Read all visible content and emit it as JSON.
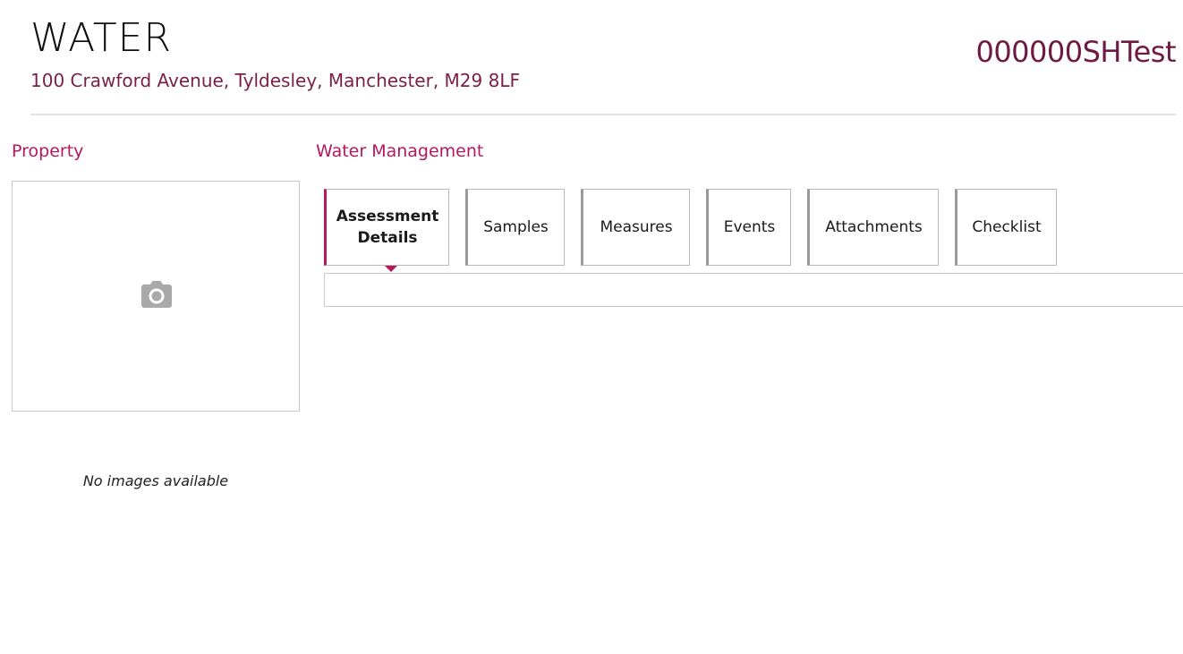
{
  "header": {
    "title": "WATER",
    "address": "100 Crawford Avenue, Tyldesley, Manchester, M29 8LF",
    "reference": "000000SHTest"
  },
  "property": {
    "heading": "Property",
    "image_icon": "camera-icon",
    "no_images_text": "No images available"
  },
  "water_management": {
    "heading": "Water Management",
    "active_tab": "Assessment Details",
    "tabs": [
      {
        "label": "Assessment Details"
      },
      {
        "label": "Samples"
      },
      {
        "label": "Measures"
      },
      {
        "label": "Events"
      },
      {
        "label": "Attachments"
      },
      {
        "label": "Checklist"
      }
    ]
  },
  "colors": {
    "accent": "#b5185d",
    "address": "#7a1f48",
    "reference": "#6e1a42",
    "icon": "#a9a9a9"
  }
}
